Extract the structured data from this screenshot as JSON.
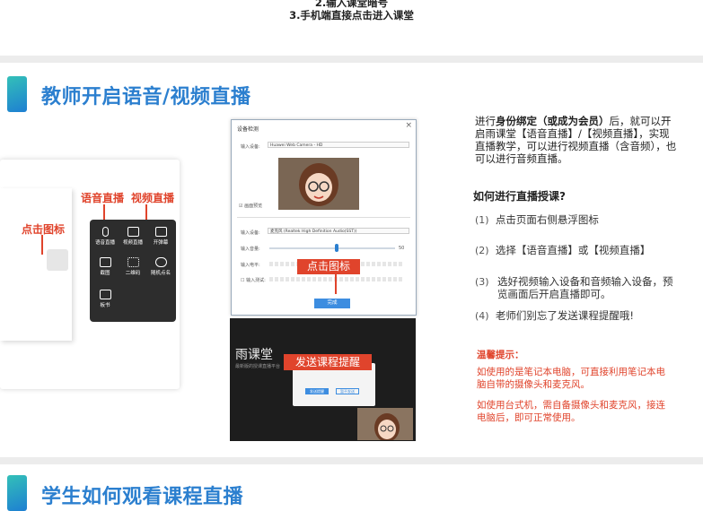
{
  "top_steps": [
    "2.输入课堂暗号",
    "3.手机端直接点击进入课堂"
  ],
  "section1": {
    "title": "教师开启语音/视频直播"
  },
  "section2": {
    "title": "学生如何观看课程直播"
  },
  "left_panel": {
    "callout_icon": "点击图标",
    "callout_voice": "语音直播",
    "callout_video": "视频直播",
    "menu": [
      "语音直播",
      "视频直播",
      "开弹幕",
      "截图",
      "二维码",
      "随机点名",
      "板书"
    ]
  },
  "dialog": {
    "title": "设备检测",
    "input_device_label": "输入设备:",
    "camera_value": "Huawei Web Camera - HD",
    "mirror_label": "画面预览",
    "audio_value": "麦克风 (Realtek High Definition Audio(SST))",
    "volume_label": "输入音量:",
    "volume_value": "50",
    "level_label": "输入电平:",
    "test_label": "输入测试:",
    "callout": "点击图标",
    "confirm": "完成"
  },
  "live_window": {
    "brand": "雨课堂",
    "subtitle": "最新版的授课直播平台",
    "callout": "发送课程提醒",
    "btn_send": "发送提醒",
    "btn_skip": "暂不发送"
  },
  "intro": {
    "pre": "进行",
    "bold": "身份绑定（或成为会员）",
    "post": "后，就可以开启雨课堂【语音直播】/【视频直播】，实现直播教学，可以进行视频直播（含音频），也可以进行音频直播。"
  },
  "howto_title": "如何进行直播授课?",
  "steps": [
    {
      "num": "(1)",
      "text": "点击页面右侧悬浮图标"
    },
    {
      "num": "(2)",
      "text": "选择【语音直播】或【视频直播】"
    },
    {
      "num": "(3)",
      "text": "选好视频输入设备和音频输入设备，预览画面后开启直播即可。"
    },
    {
      "num": "(4)",
      "text": "老师们别忘了发送课程提醒哦!"
    }
  ],
  "tips": {
    "title": "温馨提示：",
    "items": [
      "如使用的是笔记本电脑，可直接利用笔记本电脑自带的摄像头和麦克风。",
      "如使用台式机，需自备摄像头和麦克风，接连电脑后，即可正常使用。"
    ]
  },
  "colors": {
    "accent_blue": "#2b7fcf",
    "callout_red": "#e0442c",
    "teal": "#33c0b8"
  }
}
